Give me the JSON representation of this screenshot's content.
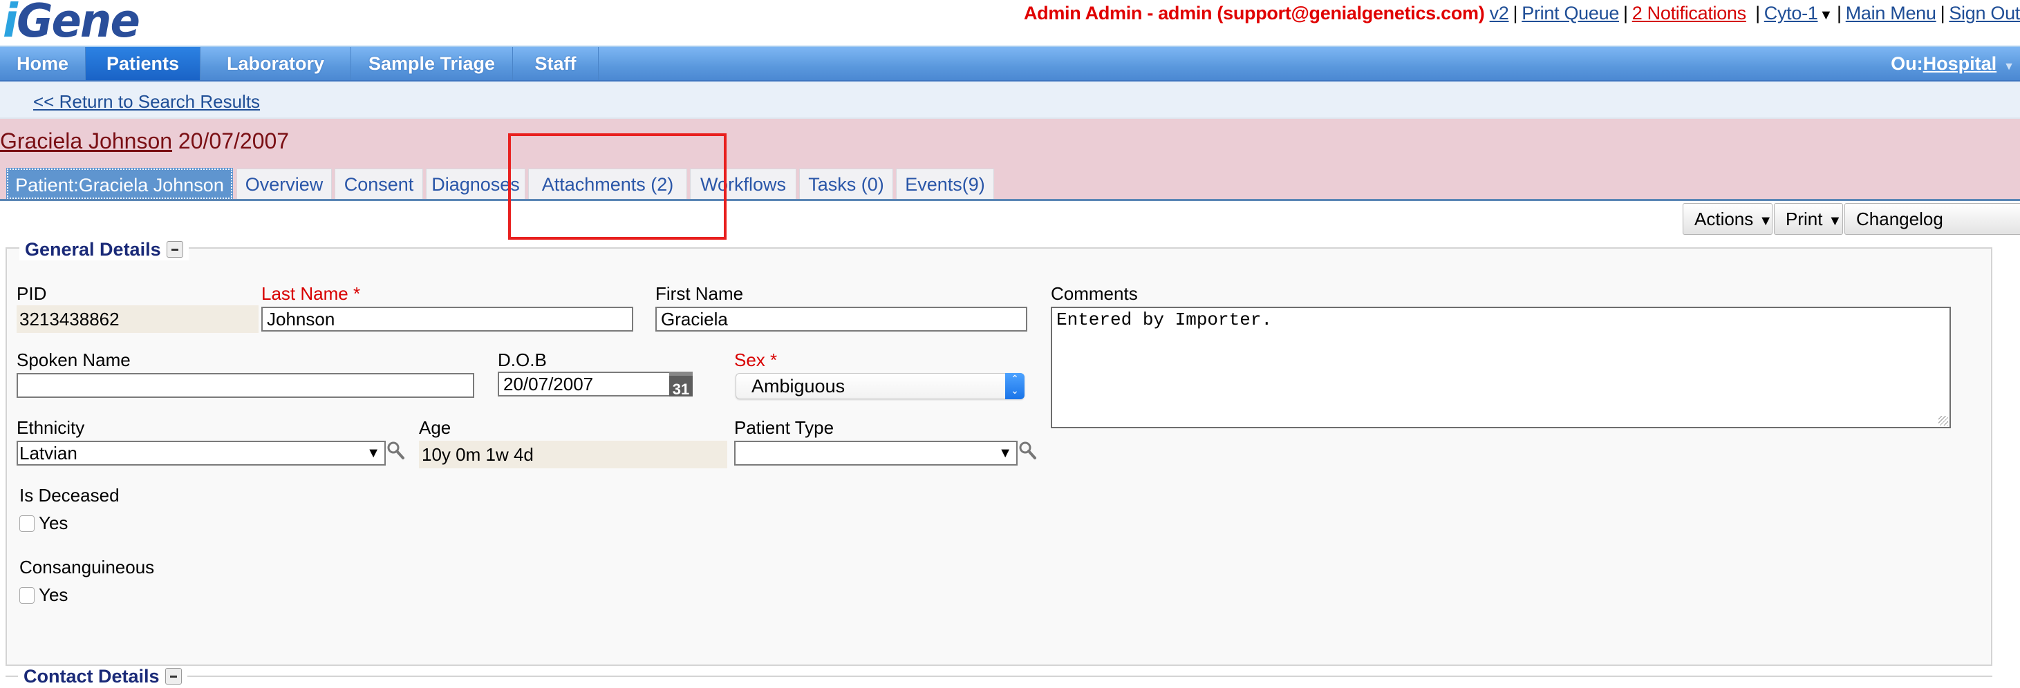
{
  "app": {
    "logo_text_i": "i",
    "logo_text_rest": "Gene"
  },
  "userbar": {
    "user": "Admin Admin - admin (support@genialgenetics.com)",
    "links": {
      "version": "v2",
      "print_queue": "Print Queue",
      "notifications": "2 Notifications",
      "lab": "Cyto-1",
      "main_menu": "Main Menu",
      "sign_out": "Sign Out"
    },
    "separator": "|",
    "caret": "▼"
  },
  "nav": {
    "items": [
      {
        "label": "Home"
      },
      {
        "label": "Patients",
        "active": true
      },
      {
        "label": "Laboratory"
      },
      {
        "label": "Sample Triage"
      },
      {
        "label": "Staff"
      }
    ],
    "ou_prefix": "Ou:",
    "ou_value": "Hospital",
    "ou_caret": "▼"
  },
  "return_link": "<< Return to Search Results",
  "patient": {
    "name": "Graciela Johnson",
    "dob": "20/07/2007"
  },
  "tabs": [
    {
      "label": "Patient:Graciela Johnson",
      "active": true
    },
    {
      "label": "Overview"
    },
    {
      "label": "Consent"
    },
    {
      "label": "Diagnoses"
    },
    {
      "label": "Attachments (2)"
    },
    {
      "label": "Workflows"
    },
    {
      "label": "Tasks (0)"
    },
    {
      "label": "Events(9)"
    }
  ],
  "actions": {
    "actions_label": "Actions",
    "print_label": "Print",
    "changelog_label": "Changelog",
    "caret": "▼"
  },
  "general_details": {
    "title": "General Details",
    "fields": {
      "pid": {
        "label": "PID",
        "value": "3213438862"
      },
      "last_name": {
        "label": "Last Name *",
        "value": "Johnson"
      },
      "first_name": {
        "label": "First Name",
        "value": "Graciela"
      },
      "comments": {
        "label": "Comments",
        "value": "Entered by Importer."
      },
      "spoken_name": {
        "label": "Spoken Name",
        "value": ""
      },
      "dob": {
        "label": "D.O.B",
        "value": "20/07/2007",
        "calendar_day": "31"
      },
      "sex": {
        "label": "Sex *",
        "value": "Ambiguous"
      },
      "ethnicity": {
        "label": "Ethnicity",
        "value": "Latvian"
      },
      "age": {
        "label": "Age",
        "value": "10y 0m 1w 4d"
      },
      "patient_type": {
        "label": "Patient Type",
        "value": ""
      },
      "is_deceased": {
        "label": "Is Deceased",
        "option": "Yes",
        "checked": false
      },
      "consanguineous": {
        "label": "Consanguineous",
        "option": "Yes",
        "checked": false
      }
    }
  },
  "contact_details": {
    "title": "Contact Details"
  },
  "colors": {
    "nav_blue": "#5a98dd",
    "patient_header_pink": "#ebcdd5",
    "required_red": "#d80000",
    "highlight_red": "#e8201f",
    "link_blue": "#1f4e96"
  }
}
